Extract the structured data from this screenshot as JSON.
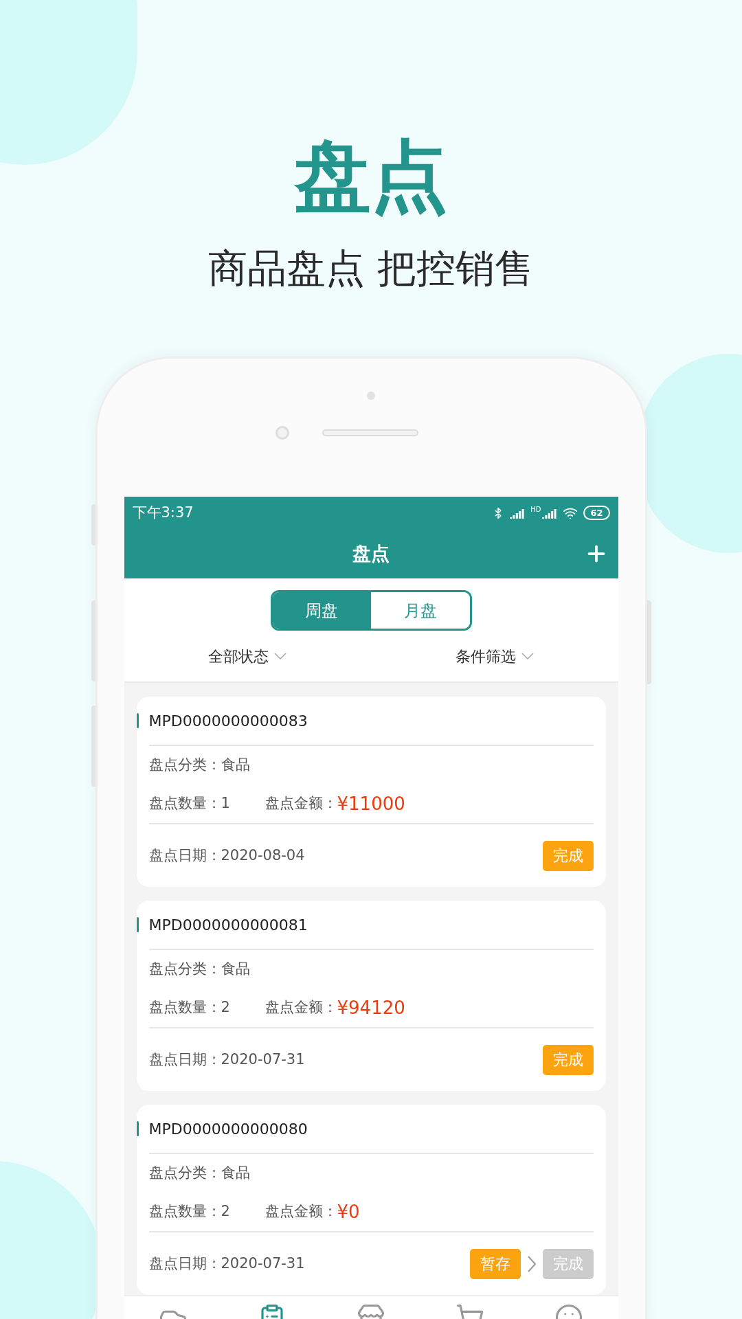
{
  "headline": "盘点",
  "subtitle": "商品盘点 把控销售",
  "status_bar": {
    "time": "下午3:37",
    "network": "HD",
    "battery": "62"
  },
  "app_bar": {
    "title": "盘点"
  },
  "segments": [
    {
      "label": "周盘",
      "selected": true
    },
    {
      "label": "月盘",
      "selected": false
    }
  ],
  "filters": [
    {
      "label": "全部状态"
    },
    {
      "label": "条件筛选"
    }
  ],
  "records": [
    {
      "id": "MPD0000000000083",
      "category_label": "盘点分类：",
      "category": "食品",
      "quantity_label": "盘点数量：",
      "quantity": "1",
      "amount_label": "盘点金额：",
      "amount": "¥11000",
      "date_label": "盘点日期：",
      "date": "2020-08-04",
      "actions": [
        {
          "label": "完成",
          "disabled": false
        }
      ]
    },
    {
      "id": "MPD0000000000081",
      "category_label": "盘点分类：",
      "category": "食品",
      "quantity_label": "盘点数量：",
      "quantity": "2",
      "amount_label": "盘点金额：",
      "amount": "¥94120",
      "date_label": "盘点日期：",
      "date": "2020-07-31",
      "actions": [
        {
          "label": "完成",
          "disabled": false
        }
      ]
    },
    {
      "id": "MPD0000000000080",
      "category_label": "盘点分类：",
      "category": "食品",
      "quantity_label": "盘点数量：",
      "quantity": "2",
      "amount_label": "盘点金额：",
      "amount": "¥0",
      "date_label": "盘点日期：",
      "date": "2020-07-31",
      "actions": [
        {
          "label": "暂存",
          "disabled": false
        },
        {
          "label": "完成",
          "disabled": true
        }
      ]
    }
  ],
  "bottom_nav": [
    {
      "selected": false
    },
    {
      "selected": true
    },
    {
      "selected": false
    },
    {
      "selected": false
    },
    {
      "selected": false
    }
  ]
}
